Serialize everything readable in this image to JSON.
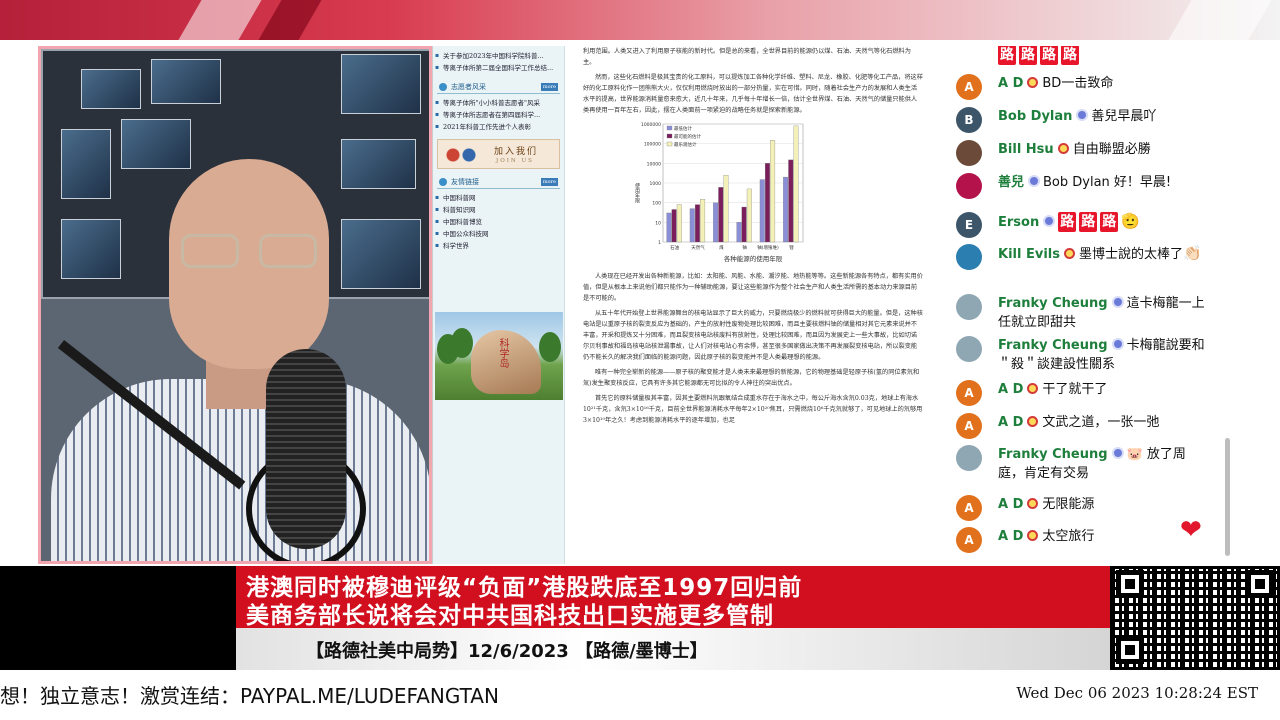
{
  "browser": {
    "sidebar": {
      "top_links": [
        "关于参加2023年中国科学院科普...",
        "等离子体所第二届全国科学工作总结..."
      ],
      "section1_title": "志愿者风采",
      "section1_more": "more",
      "section1_links": [
        "等离子体所\"小小科普志愿者\"风采",
        "等离子体所志愿者在第四届科学...",
        "2021年科普工作先进个人表彰"
      ],
      "join_title": "加入我们",
      "join_sub": "JOIN US",
      "section2_title": "友情链接",
      "section2_more": "more",
      "section2_links": [
        "中国科普网",
        "科普知识网",
        "中国科普博览",
        "中国公众科技网",
        "科学世界"
      ],
      "rock_text": "科学岛"
    },
    "article": {
      "p0": "利用范围。人类又进入了利用原子核能的新时代。但是总的来看，全世界目前的能源仍以煤、石油、天然气等化石燃料为主。",
      "p1": "然而，这些化石燃料是极其宝贵的化工原料，可以提炼加工各种化学纤维、塑料、尼龙、橡胶、化肥等化工产品，将这样好的化工原料化作一团熊熊大火，仅仅利用燃烧时放出的一部分热量，实在可惜。同时，随着社会生产力的发展和人类生活水平的提高，世界能源消耗量愈来愈大，近几十年来，几乎每十年增长一倍，估计全世界煤、石油、天然气的储量只能供人类再使用一百年左右，因此，摆在人类面前一项紧迫的战略任务就是探索新能源。",
      "caption": "各种能源的使用年限",
      "p2": "人类现在已经开发出各种新能源，比如：太阳能、风能、水能、潮汐能、地热能等等。这些新能源各有特点，都有实用价值，但是从根本上来说他们都只能作为一种辅助能源，要让这些能源作为整个社会生产和人类生活所需的基本动力来源目前是不可能的。",
      "p3": "从五十年代开始登上世界能源舞台的核电站显示了巨大的威力，只要燃烧极少的燃料就可获得巨大的能量。但是，这种核电站是以重原子核的裂变反应为基础的，产生的放射性废物处理比较困难，而且主要核燃料铀的储量相对其它元素来说并不丰富，开采和提炼又十分困难，而且裂变核电站核废料有放射性，处理比较困难，而且因为发展史上一些大事故，比如切诺尔贝利事故和福岛核电站核泄漏事故，让人们对核电站心有余悸，甚至很多国家做出决策不再发展裂变核电站，所以裂变能仍不能长久的解决我们面临的能源问题，因此原子核的裂变能并不是人类最理想的能源。",
      "p4": "唯有一种完全崭新的能源——原子核的聚变能才是人类未来最理想的新能源，它的物理基础是轻原子核(氢的同位素氘和氚)发生聚变核反应，它具有许多其它能源都无可比拟的令人神往的突出优点。",
      "p5": "首先它的原料储量极其丰富，因其主要燃料氘跟氧结合成重水存在于海水之中，每公斤海水含氘0.03克，地球上有海水10²¹千克，含氘3×10¹⁶千克，目前全世界能源消耗水平每年2×10²⁰焦耳，只需燃烧10⁶千克氘就够了，可见地球上的氘够用3×10¹⁰年之久！考虑到能源消耗水平的逐年增加，也足"
    }
  },
  "chart_data": {
    "type": "bar",
    "categories": [
      "石油",
      "天然气",
      "煤",
      "铀",
      "铀(增殖堆)",
      "锂"
    ],
    "series": [
      {
        "name": "最低估计",
        "values": [
          30,
          50,
          100,
          10,
          1500,
          2000
        ]
      },
      {
        "name": "最可能的估计",
        "values": [
          45,
          80,
          600,
          60,
          10000,
          15000
        ]
      },
      {
        "name": "最乐观估计",
        "values": [
          80,
          150,
          2500,
          500,
          150000,
          800000
        ]
      }
    ],
    "legend": [
      "最低估计",
      "最可能的估计",
      "最乐观估计"
    ],
    "ylabel": "使用年限",
    "yscale": "log",
    "ylim": [
      1,
      1000000
    ],
    "yticks": [
      "1",
      "10",
      "100",
      "1000",
      "10000",
      "100000",
      "1000000"
    ],
    "colors": [
      "#8a8fd8",
      "#7a1f5c",
      "#f3f0b8"
    ]
  },
  "chat": {
    "top_emotes": [
      "路",
      "路",
      "路",
      "路"
    ],
    "messages": [
      {
        "author": "A D",
        "initial": "A",
        "avatar_color": "#e2711d",
        "badge": true,
        "mod": false,
        "text": "BD一击致命",
        "emotes": [],
        "emoji": ""
      },
      {
        "author": "Bob Dylan",
        "initial": "B",
        "avatar_color": "#3d5568",
        "badge": false,
        "mod": true,
        "text": "善兒早晨吖",
        "emotes": [],
        "emoji": ""
      },
      {
        "author": "Bill Hsu",
        "initial": "",
        "avatar_color": "#6b4a3a",
        "badge": true,
        "mod": false,
        "text": "自由聯盟必勝",
        "emotes": [],
        "emoji": ""
      },
      {
        "author": "善兒",
        "initial": "",
        "avatar_color": "#b3124a",
        "badge": false,
        "mod": true,
        "text": "Bob Dylan 好！早晨!",
        "emotes": [],
        "emoji": ""
      },
      {
        "author": "Erson",
        "initial": "E",
        "avatar_color": "#3d5568",
        "badge": false,
        "mod": true,
        "text": "",
        "emotes": [
          "路",
          "路",
          "路"
        ],
        "emoji": "🫡"
      },
      {
        "author": "Kill Evils",
        "initial": "",
        "avatar_color": "#2a7fb0",
        "badge": true,
        "mod": false,
        "text": "墨博士說的太棒了",
        "emotes": [],
        "emoji": "👏🏻"
      },
      {
        "author": "Franky Cheung",
        "initial": "",
        "avatar_color": "#8fa7b3",
        "badge": false,
        "mod": true,
        "text": "這卡梅龍一上任就立即甜共",
        "emotes": [],
        "emoji": ""
      },
      {
        "author": "Franky Cheung",
        "initial": "",
        "avatar_color": "#8fa7b3",
        "badge": false,
        "mod": true,
        "text": "卡梅龍說要和＂殺＂談建設性關系",
        "emotes": [],
        "emoji": ""
      },
      {
        "author": "A D",
        "initial": "A",
        "avatar_color": "#e2711d",
        "badge": true,
        "mod": false,
        "text": "干了就干了",
        "emotes": [],
        "emoji": ""
      },
      {
        "author": "A D",
        "initial": "A",
        "avatar_color": "#e2711d",
        "badge": true,
        "mod": false,
        "text": "文武之道，一张一弛",
        "emotes": [],
        "emoji": ""
      },
      {
        "author": "Franky Cheung",
        "initial": "",
        "avatar_color": "#8fa7b3",
        "badge": false,
        "mod": true,
        "text": "🐷 放了周庭，肯定有交易",
        "emotes": [],
        "emoji": ""
      },
      {
        "author": "A D",
        "initial": "A",
        "avatar_color": "#e2711d",
        "badge": true,
        "mod": false,
        "text": "无限能源",
        "emotes": [],
        "emoji": ""
      },
      {
        "author": "A D",
        "initial": "A",
        "avatar_color": "#e2711d",
        "badge": true,
        "mod": false,
        "text": "太空旅行",
        "emotes": [],
        "emoji": ""
      }
    ],
    "heart_icon": "heart-icon"
  },
  "banner": {
    "headline1": "港澳同时被穆迪评级“负面”港股跌底至1997回归前",
    "headline2": "美商务部长说将会对中共国科技出口实施更多管制",
    "subtitle": "【路德社美中局势】12/6/2023 【路德/墨博士】"
  },
  "footer": {
    "ticker": "想！独立意志！激赏连结：PAYPAL.ME/LUDEFANGTAN",
    "clock": "Wed Dec 06 2023 10:28:24 EST"
  }
}
